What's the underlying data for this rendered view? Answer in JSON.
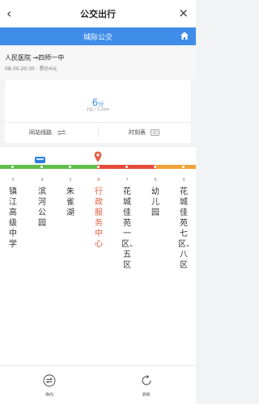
{
  "header": {
    "title": "公交出行",
    "back_glyph": "‹",
    "close_glyph": "×"
  },
  "subheader": {
    "title": "城际公交",
    "home_icon": "home-icon"
  },
  "route": {
    "name": "人民医院 →四师一中",
    "meta": "08:30-20:30 · 票价4元"
  },
  "arrival": {
    "minutes": "6",
    "unit": "分",
    "detail": "2站 / 3.2km"
  },
  "actions": {
    "same_station_label": "同站线路",
    "timetable_label": "时刻表"
  },
  "colors": {
    "accent": "#3f8de8",
    "green": "#5fbf4a",
    "red": "#e64a3b",
    "orange": "#f0a23a",
    "current": "#e65c42"
  },
  "stops": [
    {
      "num": "3",
      "name": "镇江高级中学",
      "current": false
    },
    {
      "num": "4",
      "name": "滨河公园",
      "current": false
    },
    {
      "num": "5",
      "name": "朱雀湖",
      "current": false
    },
    {
      "num": "6",
      "name": "行政服务中心",
      "current": true
    },
    {
      "num": "7",
      "name": "花城佳苑一区、五区",
      "current": false
    },
    {
      "num": "8",
      "name": "幼儿园",
      "current": false
    },
    {
      "num": "9",
      "name": "花城佳苑七区、八区",
      "current": false
    }
  ],
  "bottom": {
    "reverse_label": "换向",
    "refresh_label": "刷新"
  }
}
